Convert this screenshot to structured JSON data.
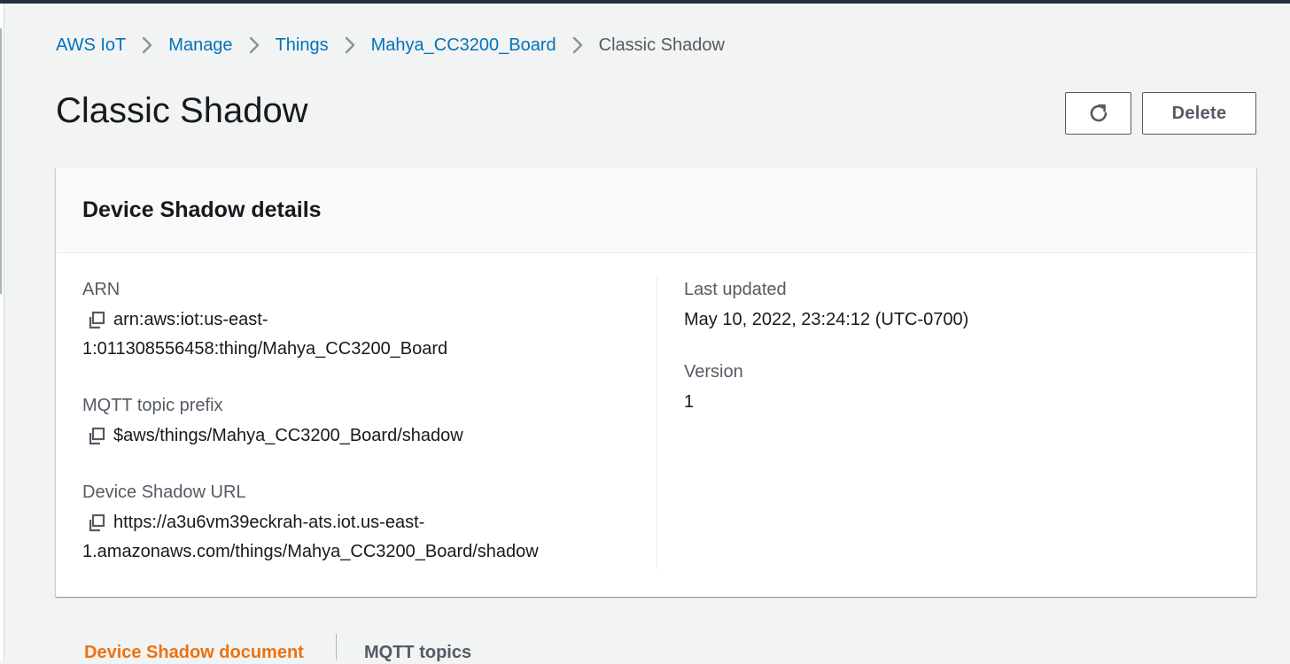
{
  "breadcrumb": {
    "items": [
      "AWS IoT",
      "Manage",
      "Things",
      "Mahya_CC3200_Board"
    ],
    "current": "Classic Shadow"
  },
  "page": {
    "title": "Classic Shadow"
  },
  "actions": {
    "refresh_icon": "refresh-icon",
    "delete_label": "Delete"
  },
  "details": {
    "title": "Device Shadow details",
    "arn": {
      "label": "ARN",
      "value_line1": "arn:aws:iot:us-east-",
      "value_line2": "1:011308556458:thing/Mahya_CC3200_Board"
    },
    "mqtt_prefix": {
      "label": "MQTT topic prefix",
      "value": "$aws/things/Mahya_CC3200_Board/shadow"
    },
    "shadow_url": {
      "label": "Device Shadow URL",
      "value_line1": "https://a3u6vm39eckrah-ats.iot.us-east-",
      "value_line2": "1.amazonaws.com/things/Mahya_CC3200_Board/shadow"
    },
    "last_updated": {
      "label": "Last updated",
      "value": "May 10, 2022, 23:24:12 (UTC-0700)"
    },
    "version": {
      "label": "Version",
      "value": "1"
    }
  },
  "tabs": {
    "active": "Device Shadow document",
    "inactive": "MQTT topics"
  },
  "colors": {
    "link": "#0073bb",
    "accent": "#ec7211",
    "text": "#16191f",
    "muted": "#545b64",
    "background": "#f2f3f3"
  }
}
